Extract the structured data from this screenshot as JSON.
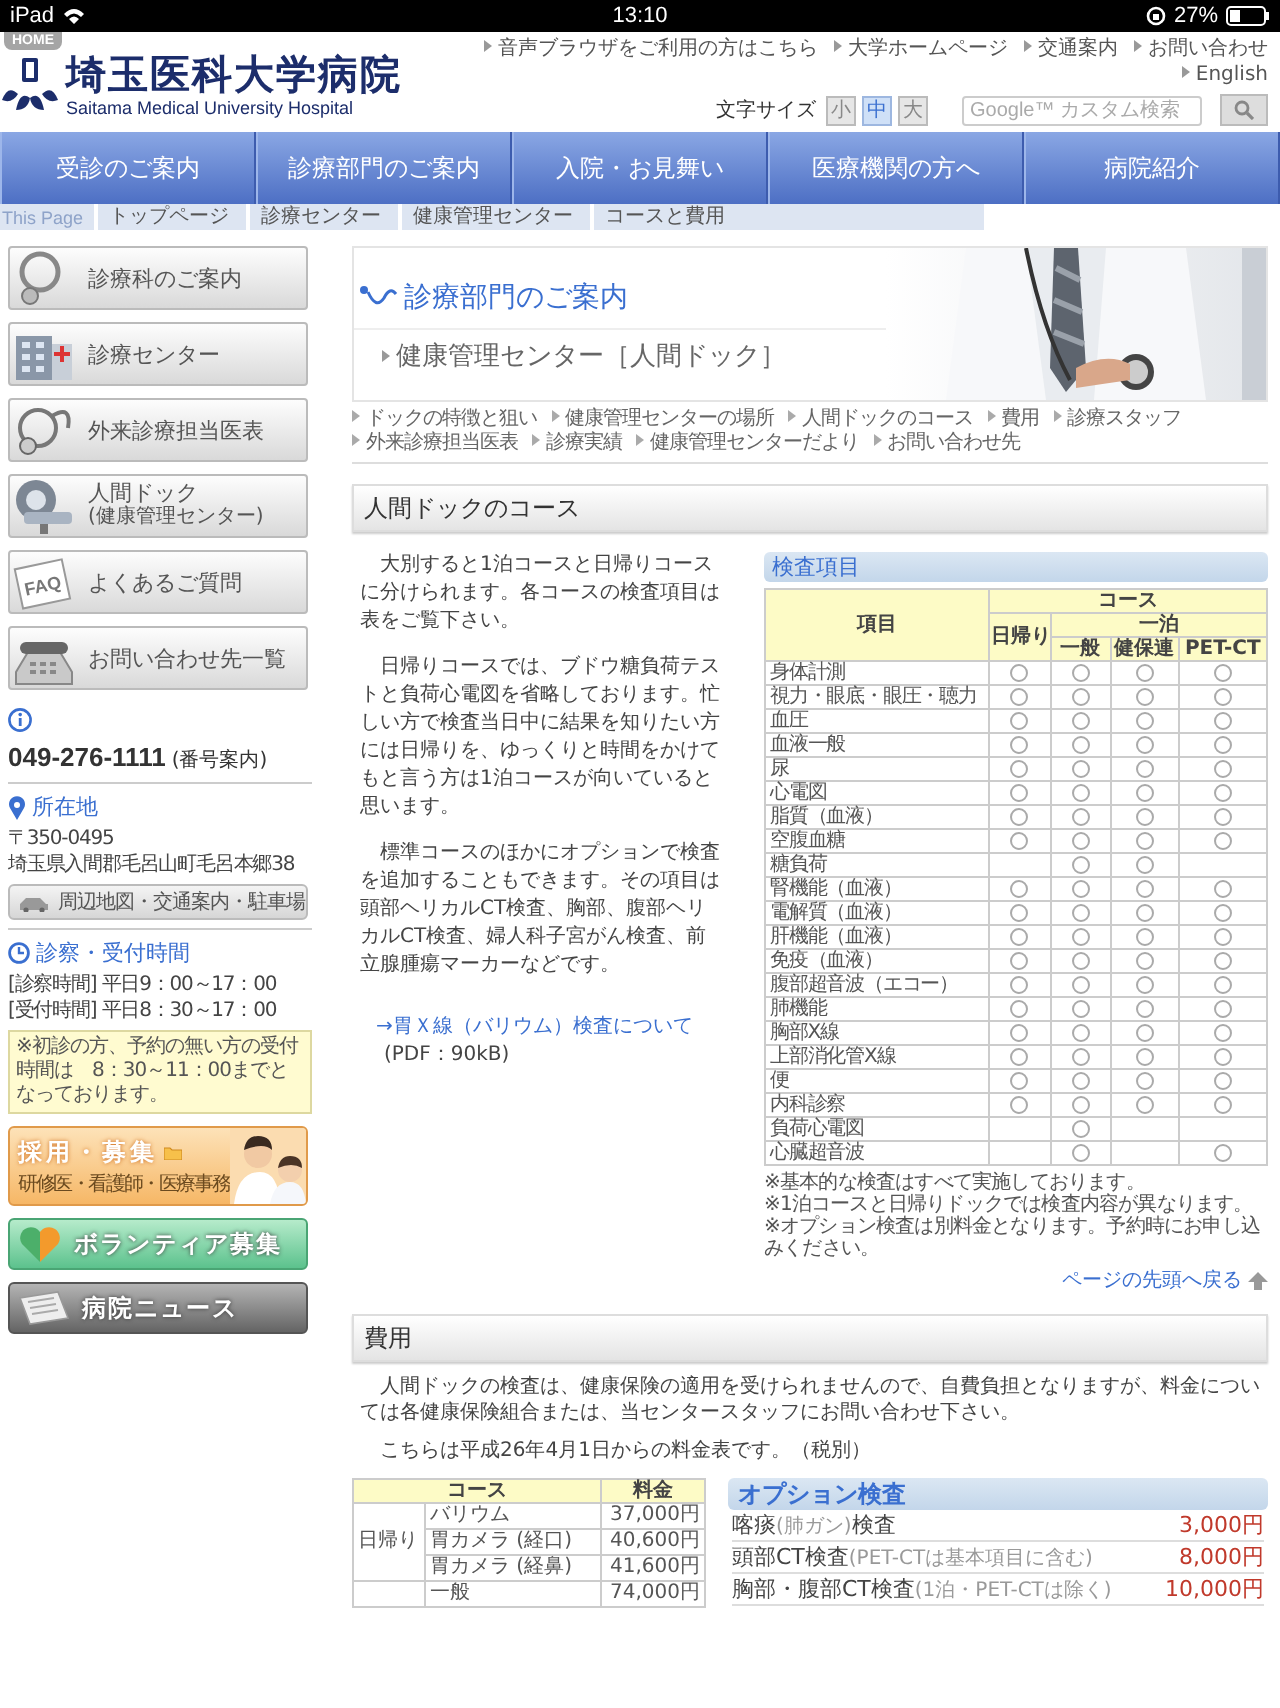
{
  "status_bar": {
    "device": "iPad",
    "time": "13:10",
    "battery": "27%"
  },
  "header": {
    "home_tab": "HOME",
    "title": "埼玉医科大学病院",
    "subtitle": "Saitama Medical University Hospital",
    "links": [
      "音声ブラウザをご利用の方はこちら",
      "大学ホームページ",
      "交通案内",
      "お問い合わせ",
      "English"
    ],
    "font_size_label": "文字サイズ",
    "font_sizes": [
      {
        "label": "小",
        "selected": false
      },
      {
        "label": "中",
        "selected": true
      },
      {
        "label": "大",
        "selected": false
      }
    ],
    "search": {
      "placeholder": "Google™ カスタム検索"
    }
  },
  "nav": [
    "受診のご案内",
    "診療部門のご案内",
    "入院・お見舞い",
    "医療機関の方へ",
    "病院紹介"
  ],
  "breadcrumb": {
    "label": "This Page",
    "items": [
      "トップページ",
      "診療センター",
      "健康管理センター",
      "コースと費用"
    ]
  },
  "sidebar": {
    "menu": [
      {
        "label": "診療科のご案内"
      },
      {
        "label": "診療センター"
      },
      {
        "label": "外来診療担当医表"
      },
      {
        "label": "人間ドック",
        "sublabel": "(健康管理センター)"
      },
      {
        "label": "よくあるご質問",
        "badge": "FAQ"
      },
      {
        "label": "お問い合わせ先一覧"
      }
    ],
    "phone": "049-276-1111",
    "phone_note": "(番号案内)",
    "location": {
      "heading": "所在地",
      "postal": "〒350-0495",
      "address": "埼玉県入間郡毛呂山町毛呂本郷38",
      "button": "周辺地図・交通案内・駐車場"
    },
    "hours": {
      "heading": "診察・受付時間",
      "lines": [
        "[診察時間] 平日9：00～17：00",
        "[受付時間] 平日8：30～17：00"
      ],
      "note": "※初診の方、予約の無い方の受付時間は　8：30～11：00までとなっております。"
    },
    "banners": {
      "recruit": {
        "title": "採用・募集",
        "subtitle": "研修医・看護師・医療事務"
      },
      "volunteer": "ボランティア募集",
      "news": "病院ニュース"
    }
  },
  "main": {
    "section_title": "診療部門のご案内",
    "page_title": "健康管理センター［人間ドック］",
    "subnav": [
      "ドックの特徴と狙い",
      "健康管理センターの場所",
      "人間ドックのコース",
      "費用",
      "診療スタッフ",
      "外来診療担当医表",
      "診療実績",
      "健康管理センターだより",
      "お問い合わせ先"
    ],
    "course": {
      "heading": "人間ドックのコース",
      "paragraphs": [
        "大別すると1泊コースと日帰りコースに分けられます。各コースの検査項目は表をご覧下さい。",
        "日帰りコースでは、ブドウ糖負荷テストと負荷心電図を省略しております。忙しい方で検査当日中に結果を知りたい方には日帰りを、ゆっくりと時間をかけてもと言う方は1泊コースが向いていると思います。",
        "標準コースのほかにオプションで検査を追加することもできます。その項目は頭部ヘリカルCT検査、胸部、腹部ヘリカルCT検査、婦人科子宮がん検査、前立腺腫瘍マーカーなどです。"
      ],
      "link": "→胃Ｘ線（バリウム）検査について",
      "link_note": "(PDF：90kB)"
    },
    "exam_table": {
      "title": "検査項目",
      "headers": {
        "item": "項目",
        "course": "コース",
        "day": "日帰り",
        "overnight": "一泊",
        "sub": [
          "一般",
          "健保連",
          "PET-CT"
        ]
      },
      "rows": [
        {
          "item": "身体計測",
          "included": [
            true,
            true,
            true,
            true
          ]
        },
        {
          "item": "視力・眼底・眼圧・聴力",
          "included": [
            true,
            true,
            true,
            true
          ]
        },
        {
          "item": "血圧",
          "included": [
            true,
            true,
            true,
            true
          ]
        },
        {
          "item": "血液一般",
          "included": [
            true,
            true,
            true,
            true
          ]
        },
        {
          "item": "尿",
          "included": [
            true,
            true,
            true,
            true
          ]
        },
        {
          "item": "心電図",
          "included": [
            true,
            true,
            true,
            true
          ]
        },
        {
          "item": "脂質（血液）",
          "included": [
            true,
            true,
            true,
            true
          ]
        },
        {
          "item": "空腹血糖",
          "included": [
            true,
            true,
            true,
            true
          ]
        },
        {
          "item": "糖負荷",
          "included": [
            false,
            true,
            true,
            false
          ]
        },
        {
          "item": "腎機能（血液）",
          "included": [
            true,
            true,
            true,
            true
          ]
        },
        {
          "item": "電解質（血液）",
          "included": [
            true,
            true,
            true,
            true
          ]
        },
        {
          "item": "肝機能（血液）",
          "included": [
            true,
            true,
            true,
            true
          ]
        },
        {
          "item": "免疫（血液）",
          "included": [
            true,
            true,
            true,
            true
          ]
        },
        {
          "item": "腹部超音波（エコー）",
          "included": [
            true,
            true,
            true,
            true
          ]
        },
        {
          "item": "肺機能",
          "included": [
            true,
            true,
            true,
            true
          ]
        },
        {
          "item": "胸部X線",
          "included": [
            true,
            true,
            true,
            true
          ]
        },
        {
          "item": "上部消化管X線",
          "included": [
            true,
            true,
            true,
            true
          ]
        },
        {
          "item": "便",
          "included": [
            true,
            true,
            true,
            true
          ]
        },
        {
          "item": "内科診察",
          "included": [
            true,
            true,
            true,
            true
          ]
        },
        {
          "item": "負荷心電図",
          "included": [
            false,
            true,
            false,
            false
          ]
        },
        {
          "item": "心臓超音波",
          "included": [
            false,
            true,
            false,
            true
          ]
        }
      ],
      "notes": [
        "※基本的な検査はすべて実施しております。",
        "※1泊コースと日帰りドックでは検査内容が異なります。",
        "※オプション検査は別料金となります。予約時にお申し込みください。"
      ]
    },
    "back_to_top": "ページの先頭へ戻る",
    "fees": {
      "heading": "費用",
      "paragraphs": [
        "人間ドックの検査は、健康保険の適用を受けられませんので、自費負担となりますが、料金については各健康保険組合または、当センタースタッフにお問い合わせ下さい。",
        "こちらは平成26年4月1日からの料金表です。（税別）"
      ],
      "price_table": {
        "headers": [
          "コース",
          "料金"
        ],
        "groups": [
          {
            "name": "日帰り",
            "rows": [
              {
                "course": "バリウム",
                "price": "37,000円"
              },
              {
                "course": "胃カメラ (経口)",
                "price": "40,600円"
              },
              {
                "course": "胃カメラ (経鼻)",
                "price": "41,600円"
              }
            ]
          },
          {
            "rows": [
              {
                "course": "一般",
                "price": "74,000円"
              }
            ]
          }
        ]
      },
      "options": {
        "title": "オプション検査",
        "items": [
          {
            "name": "喀痰",
            "note": "(肺ガン)",
            "suffix": "検査",
            "price": "3,000円"
          },
          {
            "name": "頭部CT検査",
            "note": "(PET-CTは基本項目に含む)",
            "price": "8,000円"
          },
          {
            "name": "胸部・腹部CT検査",
            "note": "(1泊・PET-CTは除く)",
            "price": "10,000円"
          }
        ]
      }
    }
  }
}
